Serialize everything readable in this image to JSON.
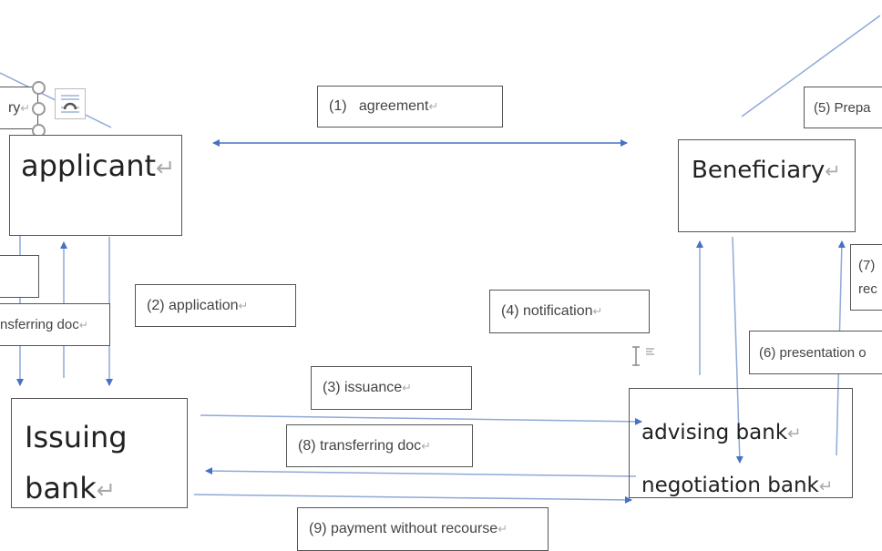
{
  "nodes": {
    "partial_top_left": "ry",
    "applicant": "applicant",
    "beneficiary": "Beneficiary",
    "issuing_bank": [
      "Issuing",
      "bank"
    ],
    "advising_bank": "advising bank",
    "negotiation_bank": "negotiation bank"
  },
  "labels": {
    "agreement": "(1)   agreement",
    "application": "(2) application",
    "issuance": "(3) issuance",
    "notification": "(4) notification",
    "prepare": "(5) Prepa",
    "presentation": "(6) presentation o",
    "step7": [
      "(7)",
      "rec"
    ],
    "transferring_doc_8": "(8) transferring doc",
    "transferring_doc_left": "nsferring doc",
    "payment": "(9) payment without recourse"
  },
  "paragraph_mark": "↵",
  "colors": {
    "arrow": "#4472c4",
    "line": "#8fa9d8",
    "border": "#555555"
  }
}
